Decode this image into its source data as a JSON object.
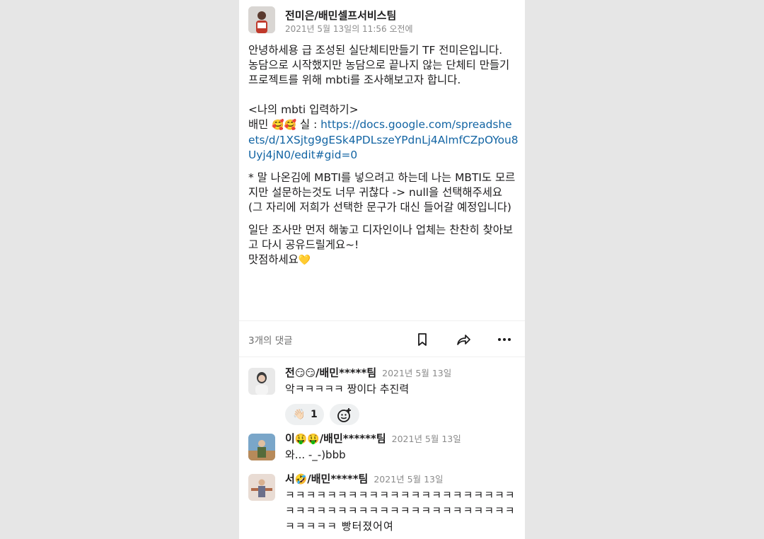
{
  "post": {
    "author": "전미은/배민셀프서비스팀",
    "timestamp": "2021년 5월 13일의 11:56 오전에",
    "line1": "안녕하세용 급 조성된 실단체티만들기 TF 전미은입니다.",
    "line2": "농담으로 시작했지만 농담으로 끝나지 않는 단체티 만들기 프로젝트를 위해 mbti를 조사해보고자 합니다.",
    "section_title": "<나의 mbti 입력하기>",
    "link_prefix": "배민",
    "link_prefix2": "실 :",
    "link": "https://docs.google.com/spreadsheets/d/1XSjtg9gESk4PDLszeYPdnLj4AlmfCZpOYou8Uyj4jN0/edit#gid=0",
    "note": "* 말 나온김에 MBTI를 넣으려고 하는데 나는 MBTI도 모르지만 설문하는것도 너무 귀찮다 -> null을 선택해주세요 (그 자리에 저희가 선택한 문구가 대신 들어갈 예정입니다)",
    "closing1": "일단 조사만 먼저 해놓고 디자인이나 업체는 찬찬히 찾아보고 다시 공유드릴게요~!",
    "closing2": "맛점하세요",
    "emoji_names": [
      "smiling-face-with-hearts-emoji",
      "yellow-heart-emoji"
    ]
  },
  "actions": {
    "comment_count": "3개의 댓글",
    "icons": [
      "bookmark-icon",
      "share-icon",
      "more-icon"
    ]
  },
  "comments": [
    {
      "author_a": "전",
      "author_b": "/배민*****팀",
      "date": "2021년 5월 13일",
      "text": "악ㅋㅋㅋㅋㅋ 짱이다 추진력",
      "reaction_count": "1"
    },
    {
      "author_a": "이",
      "author_b": "/배민******팀",
      "date": "2021년 5월 13일",
      "text": "와... -_-)bbb"
    },
    {
      "author_a": "서",
      "author_b": "/배민*****팀",
      "date": "2021년 5월 13일",
      "text": "ㅋㅋㅋㅋㅋㅋㅋㅋㅋㅋㅋㅋㅋㅋㅋㅋㅋㅋㅋㅋㅋㅋㅋㅋㅋㅋㅋㅋㅋㅋㅋㅋㅋㅋㅋㅋㅋㅋㅋㅋㅋㅋㅋㅋㅋㅋㅋㅋㅋ 빵터졌어여"
    }
  ],
  "colors": {
    "link": "#1264a3",
    "background": "#e6e6e6",
    "muted": "#8b8b8b"
  }
}
